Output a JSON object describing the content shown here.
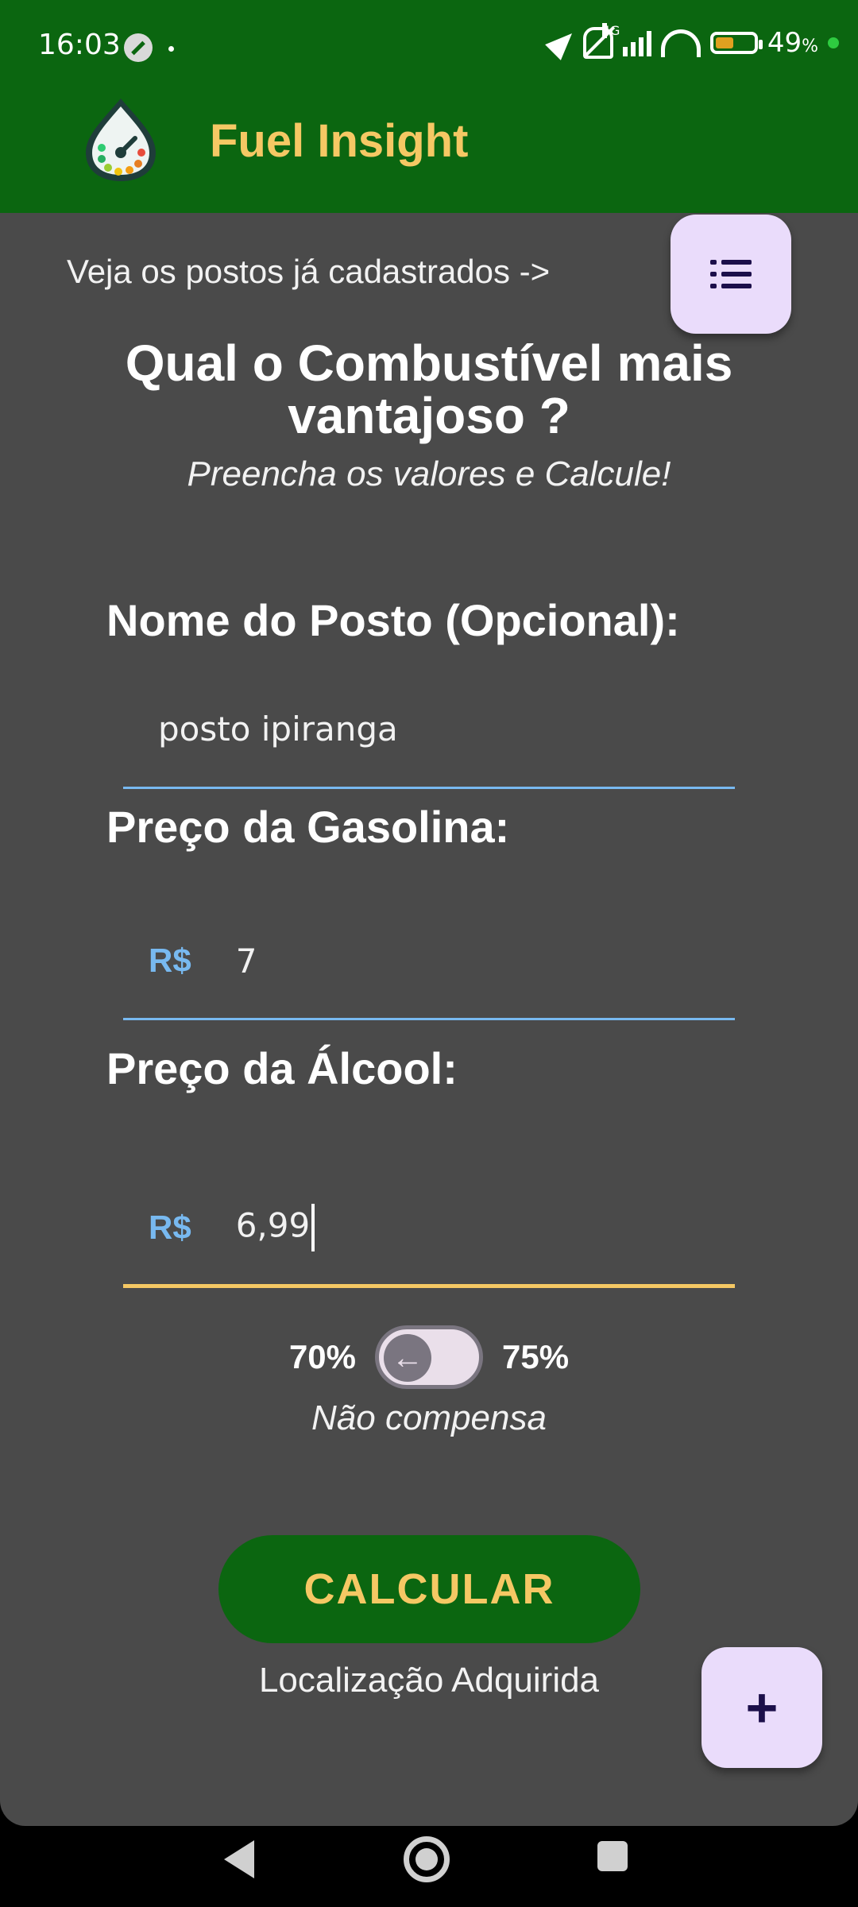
{
  "status_bar": {
    "time": "16:03",
    "network": "4G",
    "battery": "49",
    "battery_unit": "%",
    "battery_level": 0.49
  },
  "app_bar": {
    "title": "Fuel Insight"
  },
  "main": {
    "registered_hint": "Veja os postos já cadastrados ->",
    "headline": "Qual o Combustível mais vantajoso ?",
    "subhead": "Preencha os valores e Calcule!",
    "station_name": {
      "label": "Nome do Posto (Opcional):",
      "value": "posto ipiranga"
    },
    "gasoline": {
      "label": "Preço da Gasolina:",
      "prefix": "R$",
      "value": "7"
    },
    "alcohol": {
      "label": "Preço da Álcool:",
      "prefix": "R$",
      "value": "6,99"
    },
    "toggle": {
      "left_label": "70%",
      "right_label": "75%",
      "knob_icon": "←"
    },
    "result": "Não compensa",
    "calculate_label": "CALCULAR",
    "location_status": "Localização Adquirida"
  },
  "fab": {
    "add_icon": "+"
  },
  "colors": {
    "brand_green": "#0b6610",
    "accent_yellow": "#f5c864",
    "field_blue": "#78b9f0",
    "fab_bg": "#eadcfb",
    "content_bg": "#4a4a4a"
  }
}
